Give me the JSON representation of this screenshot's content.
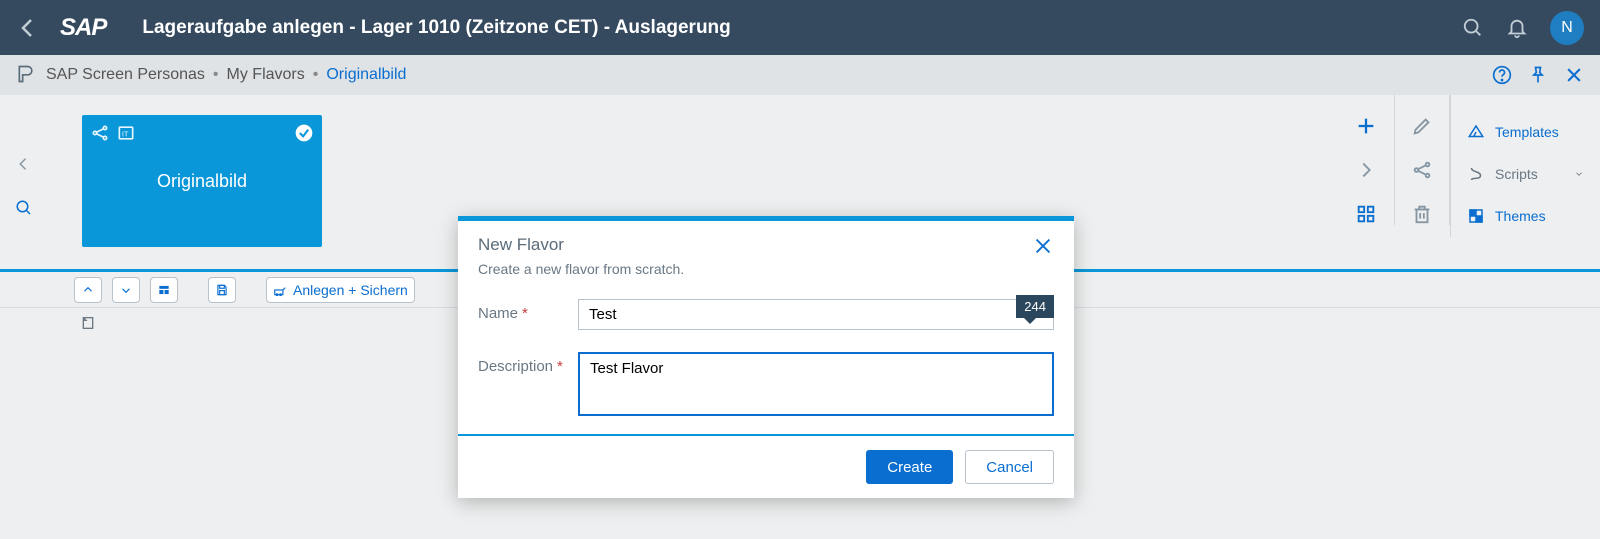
{
  "header": {
    "title": "Lageraufgabe anlegen - Lager 1010 (Zeitzone CET) - Auslagerung",
    "logo_text": "SAP",
    "avatar_initial": "N"
  },
  "breadcrumb": {
    "items": [
      {
        "label": "SAP Screen Personas"
      },
      {
        "label": "My Flavors"
      },
      {
        "label": "Originalbild"
      }
    ]
  },
  "tile": {
    "label": "Originalbild"
  },
  "right_menu": {
    "items": [
      {
        "label": "Templates"
      },
      {
        "label": "Scripts"
      },
      {
        "label": "Themes"
      }
    ]
  },
  "toolbar": {
    "create_save_label": "Anlegen + Sichern"
  },
  "dialog": {
    "title": "New Flavor",
    "subtitle": "Create a new flavor from scratch.",
    "name_label": "Name",
    "name_value": "Test",
    "desc_label": "Description",
    "desc_value": "Test Flavor",
    "count_badge": "244",
    "create_label": "Create",
    "cancel_label": "Cancel"
  }
}
